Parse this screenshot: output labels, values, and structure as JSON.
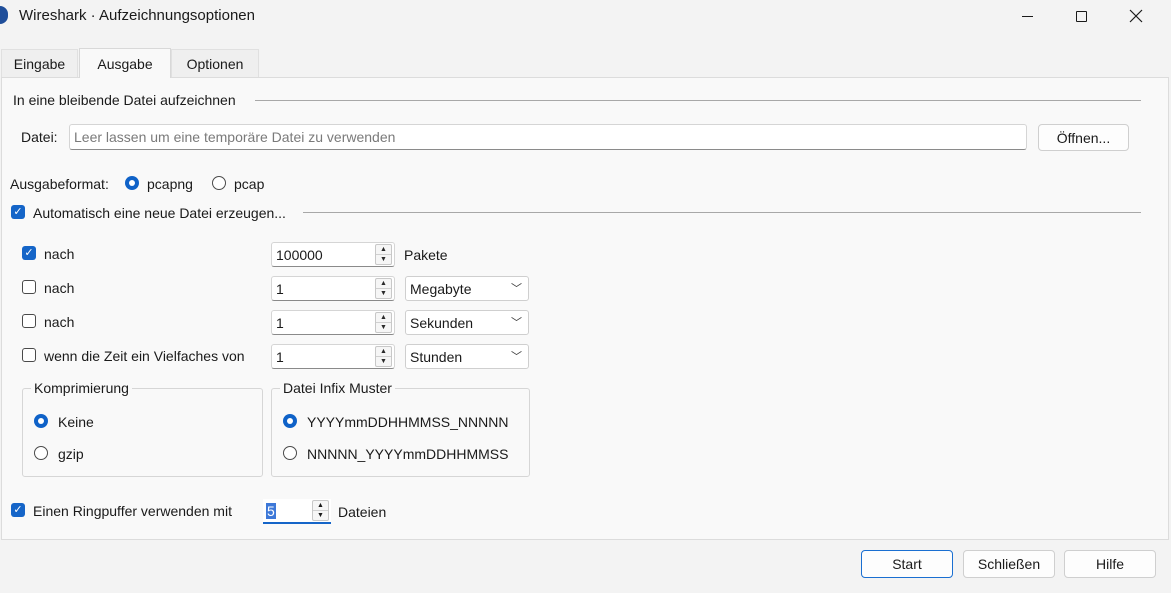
{
  "window": {
    "title": "Wireshark · Aufzeichnungsoptionen"
  },
  "tabs": [
    {
      "label": "Eingabe",
      "selected": false
    },
    {
      "label": "Ausgabe",
      "selected": true
    },
    {
      "label": "Optionen",
      "selected": false
    }
  ],
  "file_section": {
    "heading": "In eine bleibende Datei aufzeichnen",
    "file_label": "Datei:",
    "file_value": "",
    "file_placeholder": "Leer lassen um eine temporäre Datei zu verwenden",
    "open_button": "Öffnen..."
  },
  "format": {
    "label": "Ausgabeformat:",
    "options": [
      {
        "label": "pcapng",
        "selected": true
      },
      {
        "label": "pcap",
        "selected": false
      }
    ]
  },
  "auto_new_file": {
    "label": "Automatisch eine neue Datei erzeugen...",
    "checked": true,
    "rows": [
      {
        "label": "nach",
        "checked": true,
        "value": "100000",
        "unit": "Pakete",
        "unit_is_dropdown": false
      },
      {
        "label": "nach",
        "checked": false,
        "value": "1",
        "unit": "Megabyte",
        "unit_is_dropdown": true
      },
      {
        "label": "nach",
        "checked": false,
        "value": "1",
        "unit": "Sekunden",
        "unit_is_dropdown": true
      },
      {
        "label": "wenn die Zeit ein Vielfaches von",
        "checked": false,
        "value": "1",
        "unit": "Stunden",
        "unit_is_dropdown": true
      }
    ]
  },
  "compression": {
    "title": "Komprimierung",
    "options": [
      {
        "label": "Keine",
        "selected": true
      },
      {
        "label": "gzip",
        "selected": false
      }
    ]
  },
  "infix": {
    "title": "Datei Infix Muster",
    "options": [
      {
        "label": "YYYYmmDDHHMMSS_NNNNN",
        "selected": true
      },
      {
        "label": "NNNNN_YYYYmmDDHHMMSS",
        "selected": false
      }
    ]
  },
  "ring_buffer": {
    "label": "Einen Ringpuffer verwenden mit",
    "checked": true,
    "value": "5",
    "unit": "Dateien"
  },
  "footer": {
    "start": "Start",
    "close": "Schließen",
    "help": "Hilfe"
  },
  "colors": {
    "accent": "#1565c8",
    "background": "#f3f3f3"
  }
}
